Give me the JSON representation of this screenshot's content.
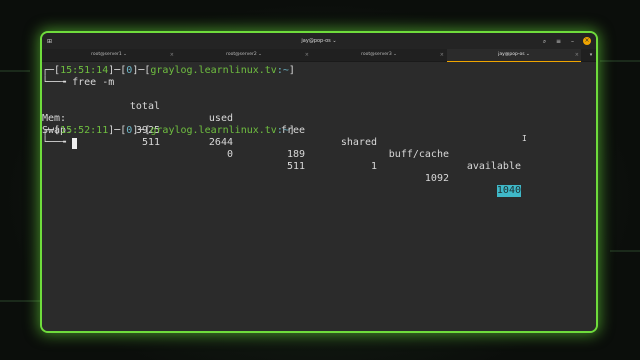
{
  "window": {
    "title": "jay@pop-os ⌄",
    "tabs": [
      {
        "label": "root@server1 ⌄",
        "active": false
      },
      {
        "label": "root@server2 ⌄",
        "active": false
      },
      {
        "label": "root@server3 ⌄",
        "active": false
      },
      {
        "label": "jay@pop-os ⌄",
        "active": true
      }
    ]
  },
  "terminal": {
    "prompt1": {
      "corner": "┌─[",
      "time": "15:51:14",
      "mid1": "]─[",
      "code": "0",
      "mid2": "]─[",
      "host": "graylog.learnlinux.tv",
      "path": ":~",
      "end": "]"
    },
    "cmd_prefix": "└──╼ ",
    "command": "free -m",
    "headers": [
      "total",
      "used",
      "free",
      "shared",
      "buff/cache",
      "available"
    ],
    "rows": [
      {
        "label": "Mem:",
        "values": [
          "3925",
          "2644",
          "189",
          "1",
          "1092",
          "1040"
        ]
      },
      {
        "label": "Swap:",
        "values": [
          "511",
          "0",
          "511",
          "",
          "",
          ""
        ]
      }
    ],
    "prompt2": {
      "corner": "┌─[",
      "time": "15:52:11",
      "mid1": "]─[",
      "code": "0",
      "mid2": "]─[",
      "host": "graylog.learnlinux.tv",
      "path": ":~",
      "end": "]"
    },
    "cmd_prefix2": "└──╼ "
  },
  "colors": {
    "accent": "#f0a500",
    "glow": "#6fdc3c",
    "prompt_green": "#6fbf40",
    "prompt_cyan": "#6fb7c9"
  }
}
